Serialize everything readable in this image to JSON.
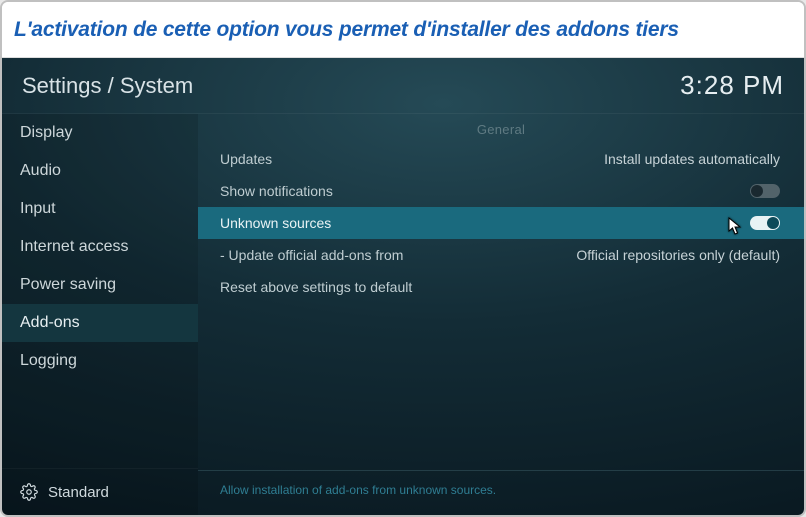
{
  "caption": "L'activation de cette option vous permet d'installer des addons tiers",
  "header": {
    "breadcrumb": "Settings / System",
    "clock": "3:28 PM"
  },
  "sidebar": {
    "items": [
      {
        "label": "Display"
      },
      {
        "label": "Audio"
      },
      {
        "label": "Input"
      },
      {
        "label": "Internet access"
      },
      {
        "label": "Power saving"
      },
      {
        "label": "Add-ons"
      },
      {
        "label": "Logging"
      }
    ],
    "footer_label": "Standard"
  },
  "main": {
    "section_header": "General",
    "rows": {
      "updates": {
        "label": "Updates",
        "value": "Install updates automatically"
      },
      "show_notifications": {
        "label": "Show notifications",
        "toggle": "off"
      },
      "unknown_sources": {
        "label": "Unknown sources",
        "toggle": "on"
      },
      "update_official": {
        "label": "- Update official add-ons from",
        "value": "Official repositories only (default)"
      },
      "reset": {
        "label": "Reset above settings to default"
      }
    },
    "hint": "Allow installation of add-ons from unknown sources."
  }
}
